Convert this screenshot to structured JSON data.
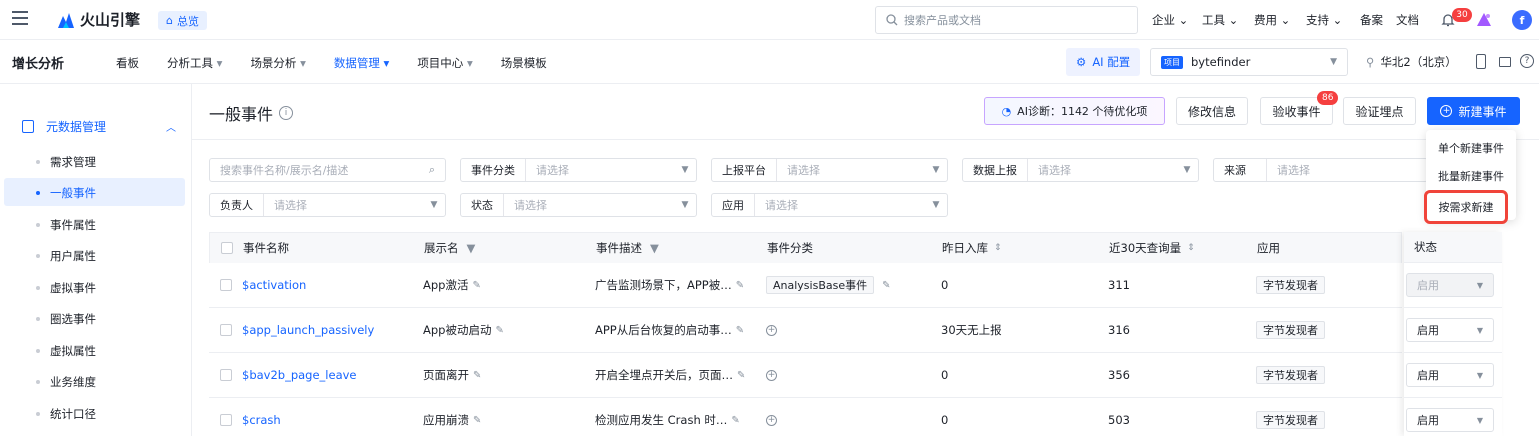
{
  "brand": {
    "name": "火山引擎",
    "overview_label": "总览"
  },
  "topbar": {
    "search_placeholder": "搜索产品或文档",
    "menus": [
      "企业",
      "工具",
      "费用",
      "支持"
    ],
    "links": [
      "备案",
      "文档"
    ],
    "notif_count": "30",
    "avatar": "f"
  },
  "secbar": {
    "product": "增长分析",
    "nav": [
      {
        "label": "看板",
        "caret": ""
      },
      {
        "label": "分析工具",
        "caret": "▾"
      },
      {
        "label": "场景分析",
        "caret": "▾"
      },
      {
        "label": "数据管理",
        "caret": "▾"
      },
      {
        "label": "项目中心",
        "caret": "▾"
      },
      {
        "label": "场景模板",
        "caret": ""
      }
    ],
    "ai_config": "AI 配置",
    "project_badge": "项目",
    "project_name": "bytefinder",
    "region": "华北2（北京）"
  },
  "sidebar": {
    "group": "元数据管理",
    "items": [
      "需求管理",
      "一般事件",
      "事件属性",
      "用户属性",
      "虚拟事件",
      "圈选事件",
      "虚拟属性",
      "业务维度",
      "统计口径"
    ]
  },
  "page": {
    "title": "一般事件",
    "ai_diag": "AI诊断：1142 个待优化项",
    "modify": "修改信息",
    "accept": "验收事件",
    "accept_badge": "86",
    "verify": "验证埋点",
    "create": "新建事件"
  },
  "dropdown": [
    "单个新建事件",
    "批量新建事件",
    "按需求新建"
  ],
  "filters": {
    "search_placeholder": "搜索事件名称/展示名/描述",
    "placeholder": "请选择",
    "row1": [
      "事件分类",
      "上报平台",
      "数据上报",
      "来源"
    ],
    "row2": [
      "负责人",
      "状态",
      "应用"
    ]
  },
  "table": {
    "headers": [
      "事件名称",
      "展示名",
      "事件描述",
      "事件分类",
      "昨日入库",
      "近30天查询量",
      "应用",
      "状态"
    ],
    "rows": [
      {
        "name": "$activation",
        "display": "App激活",
        "desc": "广告监测场景下，APP被…",
        "category": "AnalysisBase事件",
        "yesterday": "0",
        "queries": "311",
        "app": "字节发现者",
        "status": "启用"
      },
      {
        "name": "$app_launch_passively",
        "display": "App被动启动",
        "desc": "APP从后台恢复的启动事…",
        "category": "",
        "yesterday": "30天无上报",
        "queries": "316",
        "app": "字节发现者",
        "status": "启用"
      },
      {
        "name": "$bav2b_page_leave",
        "display": "页面离开",
        "desc": "开启全埋点开关后，页面…",
        "category": "",
        "yesterday": "0",
        "queries": "356",
        "app": "字节发现者",
        "status": "启用"
      },
      {
        "name": "$crash",
        "display": "应用崩溃",
        "desc": "检测应用发生 Crash 时…",
        "category": "",
        "yesterday": "0",
        "queries": "503",
        "app": "字节发现者",
        "status": "启用"
      }
    ]
  }
}
